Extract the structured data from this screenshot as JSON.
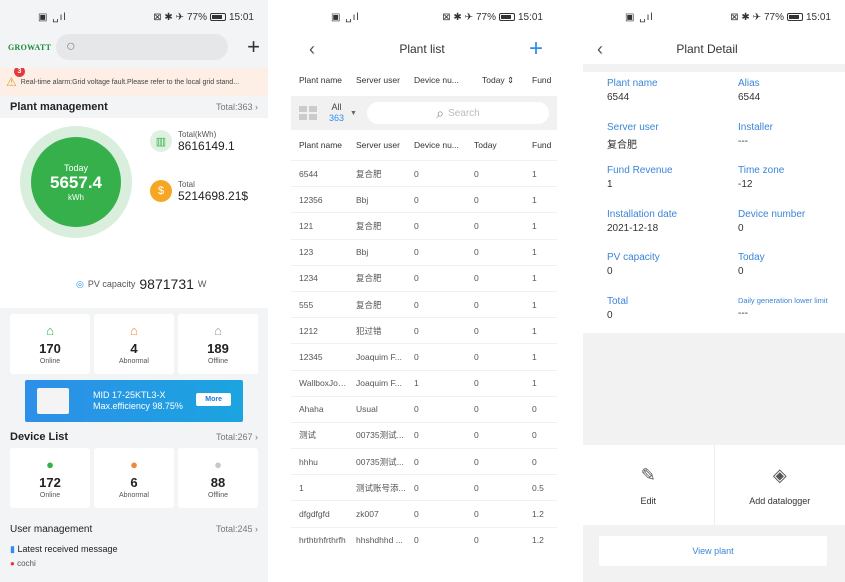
{
  "status": {
    "time": "15:01",
    "battery": "77%"
  },
  "home": {
    "logo": "GROWATT",
    "alarm_count": "3",
    "alarm_text": "Real-time alarm:Grid voltage fault.Please refer to the local grid stand...",
    "plant_mgmt": {
      "title": "Plant management",
      "total": "Total:363"
    },
    "today_label": "Today",
    "today_value": "5657.4",
    "today_unit": "kWh",
    "total_kwh_label": "Total(kWh)",
    "total_kwh_value": "8616149.1",
    "total_money_label": "Total",
    "total_money_value": "5214698.21$",
    "pv_label": "PV capacity",
    "pv_value": "9871731",
    "pv_unit": "W",
    "plant_stats": [
      {
        "value": "170",
        "label": "Online",
        "color": "#36b04a"
      },
      {
        "value": "4",
        "label": "Abnormal",
        "color": "#f08a3a"
      },
      {
        "value": "189",
        "label": "Offline",
        "color": "#9a9a9a"
      }
    ],
    "banner_line1": "MID 17-25KTL3-X",
    "banner_line2": "Max.efficiency 98.75%",
    "banner_more": "More",
    "device_list": {
      "title": "Device List",
      "total": "Total:267"
    },
    "device_stats": [
      {
        "value": "172",
        "label": "Online",
        "color": "#36b04a"
      },
      {
        "value": "6",
        "label": "Abnormal",
        "color": "#f08a3a"
      },
      {
        "value": "88",
        "label": "Offline",
        "color": "#c8c8c8"
      }
    ],
    "user_mgmt": {
      "title": "User management",
      "total": "Total:245"
    },
    "latest_msg": "Latest received message",
    "msg_item": "cochi"
  },
  "plant_list": {
    "title": "Plant list",
    "columns": [
      "Plant name",
      "Server user",
      "Device nu...",
      "Today",
      "Fund"
    ],
    "filter_all": "All",
    "filter_count": "363",
    "search_placeholder": "Search",
    "rows": [
      [
        "6544",
        "复合肥",
        "0",
        "0",
        "1"
      ],
      [
        "12356",
        "Bbj",
        "0",
        "0",
        "1"
      ],
      [
        "121",
        "复合肥",
        "0",
        "0",
        "1"
      ],
      [
        "123",
        "Bbj",
        "0",
        "0",
        "1"
      ],
      [
        "1234",
        "复合肥",
        "0",
        "0",
        "1"
      ],
      [
        "555",
        "复合肥",
        "0",
        "0",
        "1"
      ],
      [
        "1212",
        "犯过错",
        "0",
        "0",
        "1"
      ],
      [
        "12345",
        "Joaquim F...",
        "0",
        "0",
        "1"
      ],
      [
        "WallboxJoa...",
        "Joaquim F...",
        "1",
        "0",
        "1"
      ],
      [
        "Ahaha",
        "Usual",
        "0",
        "0",
        "0"
      ],
      [
        "测试",
        "00735测试...",
        "0",
        "0",
        "0"
      ],
      [
        "hhhu",
        "00735测试...",
        "0",
        "0",
        "0"
      ],
      [
        "1",
        "测试账号添...",
        "0",
        "0",
        "0.5"
      ],
      [
        "dfgdfgfd",
        "zk007",
        "0",
        "0",
        "1.2"
      ],
      [
        "hrthtrhfrthrfh",
        "hhshdhhd ...",
        "0",
        "0",
        "1.2"
      ]
    ]
  },
  "plant_detail": {
    "title": "Plant Detail",
    "fields": [
      {
        "label": "Plant name",
        "value": "6544"
      },
      {
        "label": "Alias",
        "value": "6544"
      },
      {
        "label": "Server user",
        "value": "复合肥"
      },
      {
        "label": "Installer",
        "value": "---"
      },
      {
        "label": "Fund Revenue",
        "value": "1"
      },
      {
        "label": "Time zone",
        "value": "-12"
      },
      {
        "label": "Installation date",
        "value": "2021-12-18"
      },
      {
        "label": "Device number",
        "value": "0"
      },
      {
        "label": "PV capacity",
        "value": "0"
      },
      {
        "label": "Today",
        "value": "0"
      },
      {
        "label": "Total",
        "value": "0"
      },
      {
        "label": "Daily generation lower limit",
        "value": "---"
      }
    ],
    "edit_label": "Edit",
    "add_datalogger_label": "Add datalogger",
    "view_plant_label": "View plant"
  }
}
